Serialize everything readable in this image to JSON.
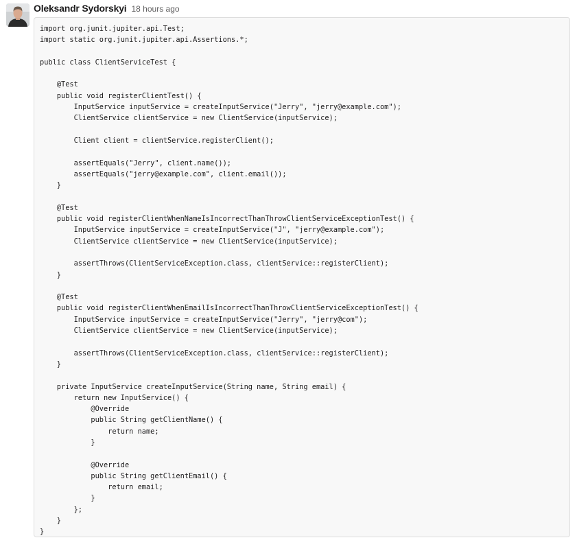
{
  "message": {
    "author": "Oleksandr Sydorskyi",
    "timestamp": "18 hours ago",
    "avatar_icon": "user-avatar",
    "code": "import org.junit.jupiter.api.Test;\nimport static org.junit.jupiter.api.Assertions.*;\n\npublic class ClientServiceTest {\n\n    @Test\n    public void registerClientTest() {\n        InputService inputService = createInputService(\"Jerry\", \"jerry@example.com\");\n        ClientService clientService = new ClientService(inputService);\n\n        Client client = clientService.registerClient();\n\n        assertEquals(\"Jerry\", client.name());\n        assertEquals(\"jerry@example.com\", client.email());\n    }\n\n    @Test\n    public void registerClientWhenNameIsIncorrectThanThrowClientServiceExceptionTest() {\n        InputService inputService = createInputService(\"J\", \"jerry@example.com\");\n        ClientService clientService = new ClientService(inputService);\n\n        assertThrows(ClientServiceException.class, clientService::registerClient);\n    }\n\n    @Test\n    public void registerClientWhenEmailIsIncorrectThanThrowClientServiceExceptionTest() {\n        InputService inputService = createInputService(\"Jerry\", \"jerry@com\");\n        ClientService clientService = new ClientService(inputService);\n\n        assertThrows(ClientServiceException.class, clientService::registerClient);\n    }\n\n    private InputService createInputService(String name, String email) {\n        return new InputService() {\n            @Override\n            public String getClientName() {\n                return name;\n            }\n\n            @Override\n            public String getClientEmail() {\n                return email;\n            }\n        };\n    }\n}"
  }
}
